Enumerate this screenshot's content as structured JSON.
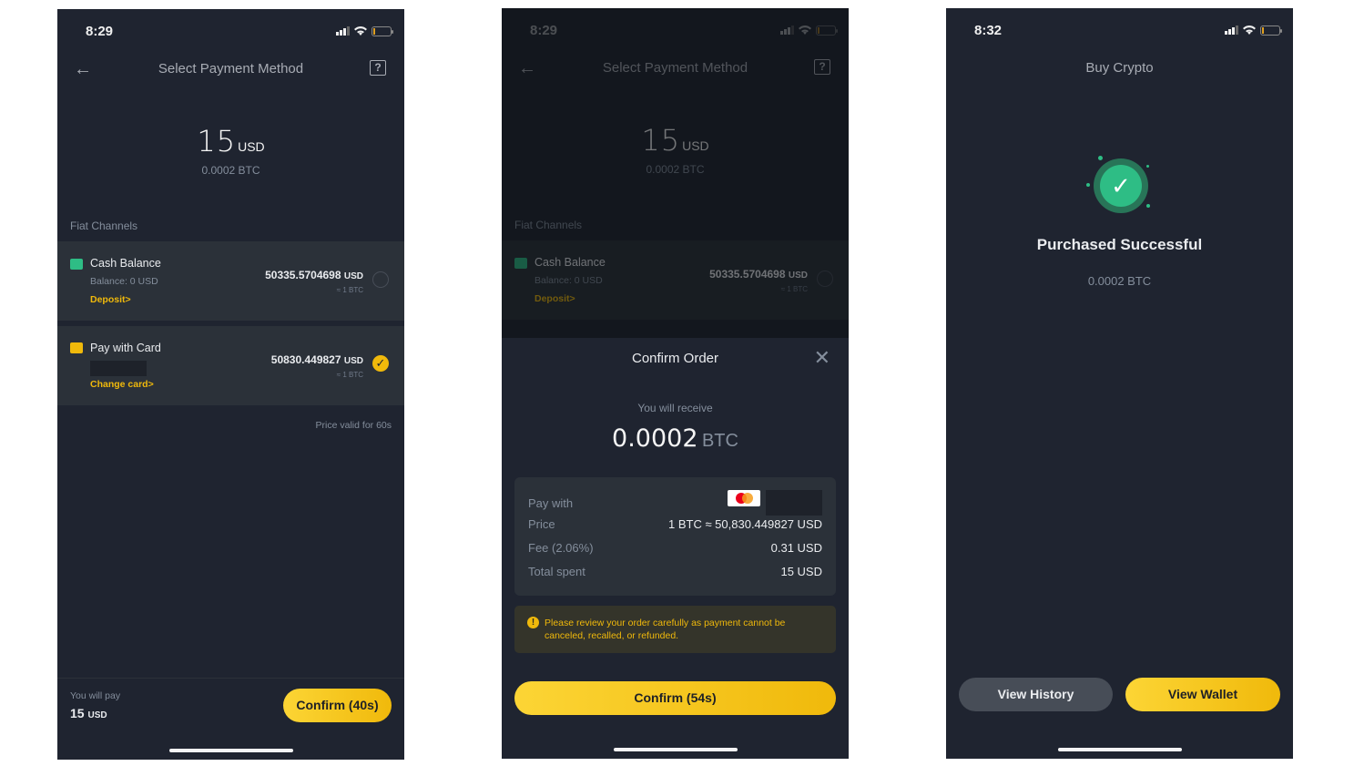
{
  "screens": [
    {
      "status": {
        "time": "8:29"
      },
      "header": {
        "title": "Select Payment Method",
        "back_icon": "arrow-left-icon",
        "help_icon": "help-icon"
      },
      "amount": {
        "value": "15",
        "currency": "USD",
        "crypto": "0.0002 BTC"
      },
      "section_label": "Fiat Channels",
      "channels": [
        {
          "name": "Cash Balance",
          "balance": "Balance:  0 USD",
          "link": "Deposit>",
          "price": "50335.5704698",
          "price_currency": "USD",
          "btc": "≈ 1 BTC",
          "selected": false,
          "icon": "cash-icon",
          "icon_color": "#2ebd85"
        },
        {
          "name": "Pay with Card",
          "link": "Change card>",
          "price": "50830.449827",
          "price_currency": "USD",
          "btc": "≈ 1  BTC",
          "selected": true,
          "icon": "card-icon",
          "icon_color": "#f0b90b"
        }
      ],
      "price_valid": "Price valid for 60s",
      "footer": {
        "label": "You will pay",
        "value": "15",
        "currency": "USD",
        "confirm": "Confirm (40s)"
      }
    },
    {
      "status": {
        "time": "8:29"
      },
      "header": {
        "title": "Select Payment Method"
      },
      "amount": {
        "value": "15",
        "currency": "USD",
        "crypto": "0.0002 BTC"
      },
      "section_label": "Fiat Channels",
      "channel": {
        "name": "Cash Balance",
        "balance": "Balance:  0 USD",
        "link": "Deposit>",
        "price": "50335.5704698",
        "price_currency": "USD",
        "btc": "≈ 1 BTC"
      },
      "sheet": {
        "title": "Confirm Order",
        "receive_label": "You will receive",
        "receive_value": "0.0002",
        "receive_currency": "BTC",
        "rows": [
          {
            "key": "Pay with",
            "value": ""
          },
          {
            "key": "Price",
            "value": "1 BTC ≈ 50,830.449827 USD"
          },
          {
            "key": "Fee (2.06%)",
            "value": "0.31 USD"
          },
          {
            "key": "Total spent",
            "value": "15 USD"
          }
        ],
        "warning": "Please review your order carefully as payment cannot be canceled, recalled, or refunded.",
        "confirm": "Confirm (54s)"
      }
    },
    {
      "status": {
        "time": "8:32"
      },
      "header": {
        "title": "Buy Crypto"
      },
      "result": {
        "title": "Purchased Successful",
        "amount": "0.0002 BTC"
      },
      "buttons": {
        "history": "View History",
        "wallet": "View Wallet"
      }
    }
  ]
}
